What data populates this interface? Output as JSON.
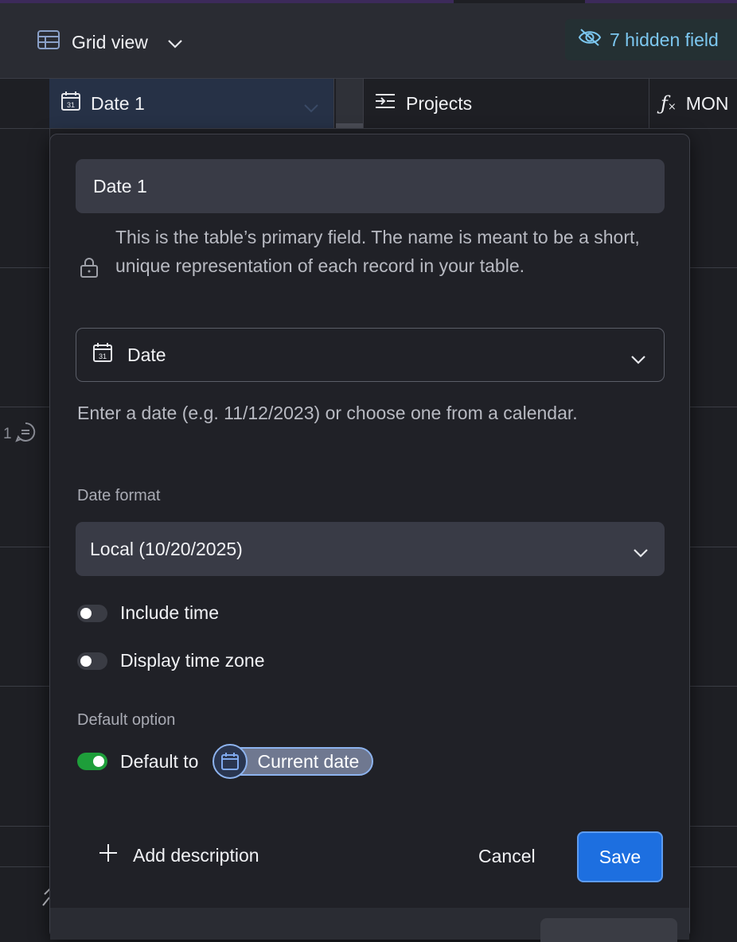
{
  "toolbar": {
    "view_name": "Grid view",
    "hidden_fields_label": "7 hidden field"
  },
  "columns": [
    {
      "label": "Date 1",
      "icon": "calendar-icon"
    },
    {
      "label": "Projects",
      "icon": "link-icon"
    },
    {
      "label": "MON",
      "icon": "formula-icon"
    }
  ],
  "grid": {
    "comment_count": "1"
  },
  "field_editor": {
    "field_name": "Date 1",
    "primary_field_note": "This is the table’s primary field. The name is meant to be a short, unique representation of each record in your table.",
    "field_type": "Date",
    "field_type_description": "Enter a date (e.g. 11/12/2023) or choose one from a calendar.",
    "date_format_label": "Date format",
    "date_format_value": "Local (10/20/2025)",
    "include_time_label": "Include time",
    "include_time_on": false,
    "display_time_zone_label": "Display time zone",
    "display_time_zone_on": false,
    "default_option_label": "Default option",
    "default_to_label": "Default to",
    "default_to_on": true,
    "default_value_chip": "Current date",
    "add_description_label": "Add description",
    "cancel_label": "Cancel",
    "save_label": "Save"
  },
  "colors": {
    "accent": "#1d6fe0",
    "toggle_on": "#1e9e3a",
    "hidden_fields_text": "#7cc7f0"
  }
}
